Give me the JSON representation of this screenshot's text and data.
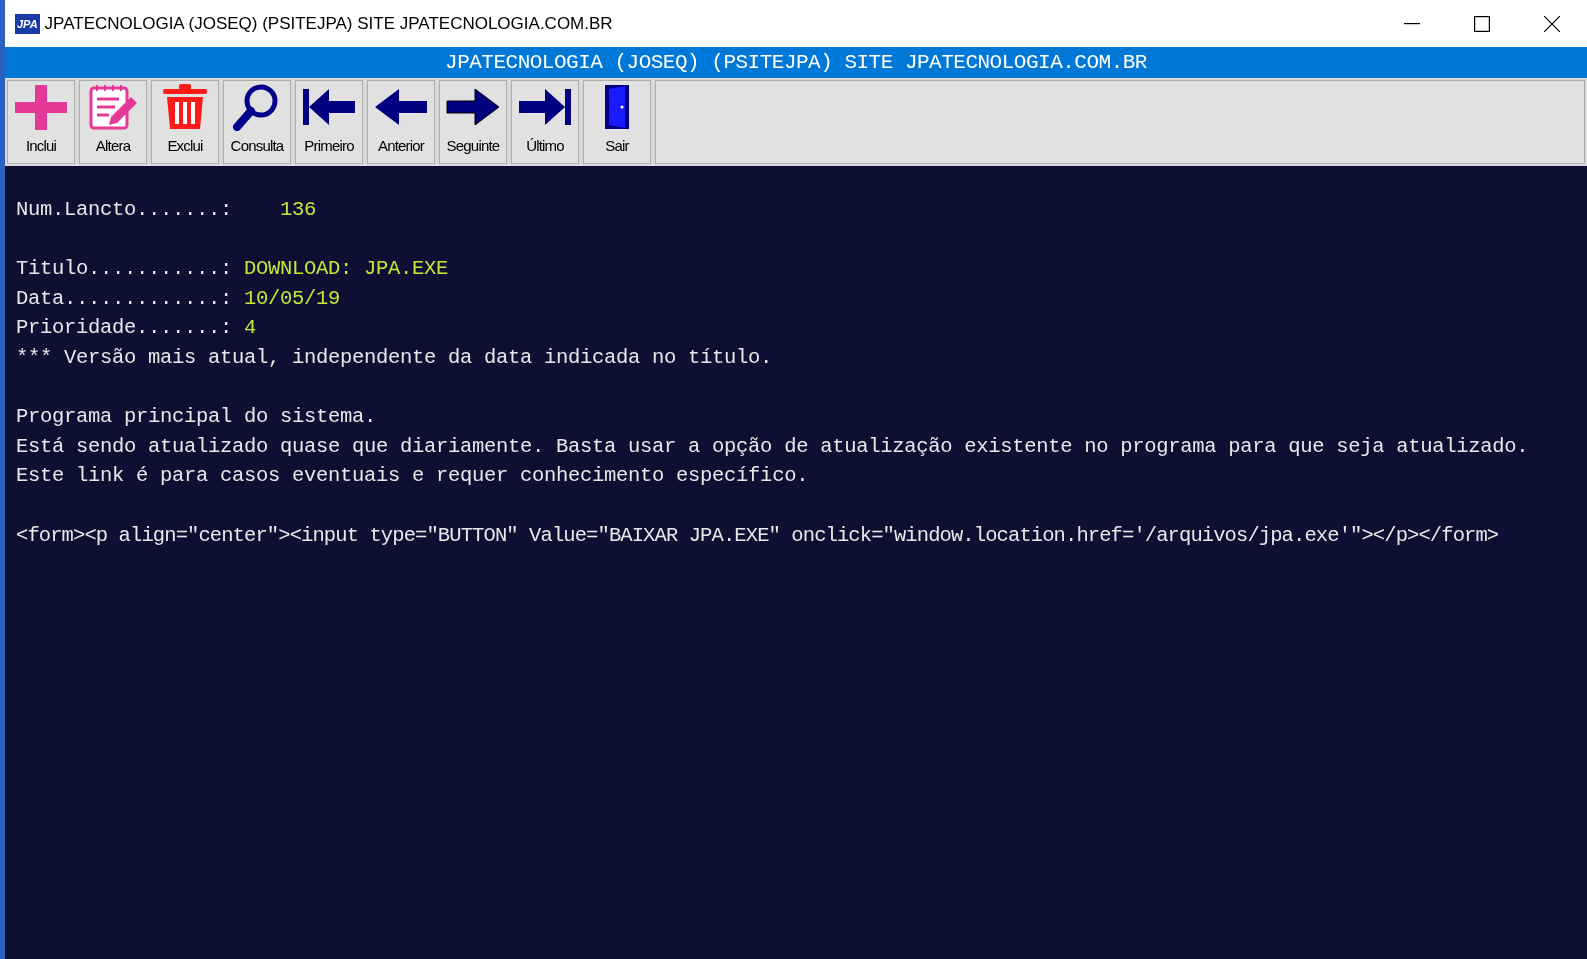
{
  "window": {
    "title": "JPATECNOLOGIA (JOSEQ) (PSITEJPA) SITE JPATECNOLOGIA.COM.BR",
    "app_icon": "JPA"
  },
  "banner": "JPATECNOLOGIA (JOSEQ) (PSITEJPA) SITE JPATECNOLOGIA.COM.BR",
  "toolbar": [
    {
      "label": "Inclui",
      "kind": "add"
    },
    {
      "label": "Altera",
      "kind": "edit"
    },
    {
      "label": "Exclui",
      "kind": "delete"
    },
    {
      "label": "Consulta",
      "kind": "search"
    },
    {
      "label": "Primeiro",
      "kind": "first"
    },
    {
      "label": "Anterior",
      "kind": "previous"
    },
    {
      "label": "Seguinte",
      "kind": "next"
    },
    {
      "label": "Último",
      "kind": "last"
    },
    {
      "label": "Sair",
      "kind": "exit"
    }
  ],
  "record_number": {
    "label": "Num.Lancto.......:",
    "value": "136"
  },
  "fields": [
    {
      "label": "Titulo...........:",
      "value": "DOWNLOAD: JPA.EXE"
    },
    {
      "label": "Data.............:",
      "value": "10/05/19"
    },
    {
      "label": "Prioridade.......:",
      "value": "4"
    }
  ],
  "note": "*** Versão mais atual, independente da data indicada no título.",
  "description": [
    "Programa principal do sistema.",
    "Está sendo atualizado quase que diariamente. Basta usar a opção de atualização existente no programa para que seja atualizado.",
    "Este link é para casos eventuais e requer conhecimento específico."
  ],
  "html_code": "<form><p align=\"center\"><input type=\"BUTTON\" Value=\"BAIXAR JPA.EXE\" onclick=\"window.location.href='/arquivos/jpa.exe'\"></p></form>"
}
